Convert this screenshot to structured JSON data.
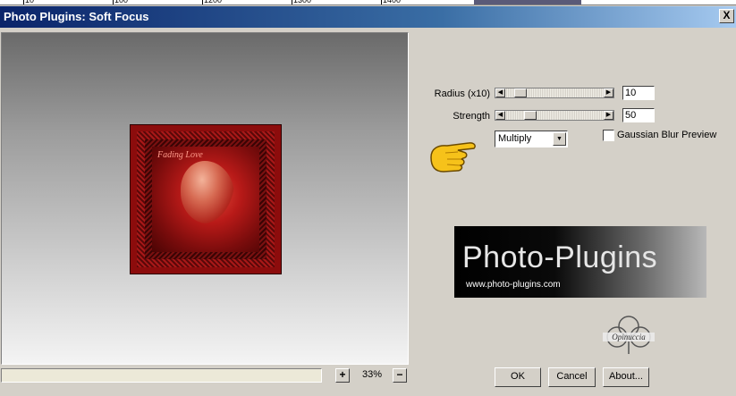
{
  "ruler": {
    "ticks": [
      "10",
      "100",
      "1200",
      "1300",
      "1400"
    ]
  },
  "window": {
    "title": "Photo Plugins: Soft Focus",
    "close_label": "X"
  },
  "preview": {
    "image_caption": "Fading Love"
  },
  "zoom": {
    "plus_label": "+",
    "minus_label": "−",
    "value": "33%"
  },
  "controls": {
    "radius": {
      "label": "Radius (x10)",
      "value": "10",
      "level": 0.1
    },
    "strength": {
      "label": "Strength",
      "value": "50",
      "level": 0.22
    },
    "blend_mode": {
      "selected": "Multiply"
    },
    "gaussian": {
      "label": "Gaussian Blur Preview",
      "checked": false
    }
  },
  "logo": {
    "title": "Photo-Plugins",
    "url": "www.photo-plugins.com",
    "signature": "Opinuccia"
  },
  "buttons": {
    "ok": "OK",
    "cancel": "Cancel",
    "about": "About..."
  },
  "colors": {
    "titlebar": "#0a246a",
    "face": "#d4d0c8",
    "photo": "#8c0c0c"
  }
}
